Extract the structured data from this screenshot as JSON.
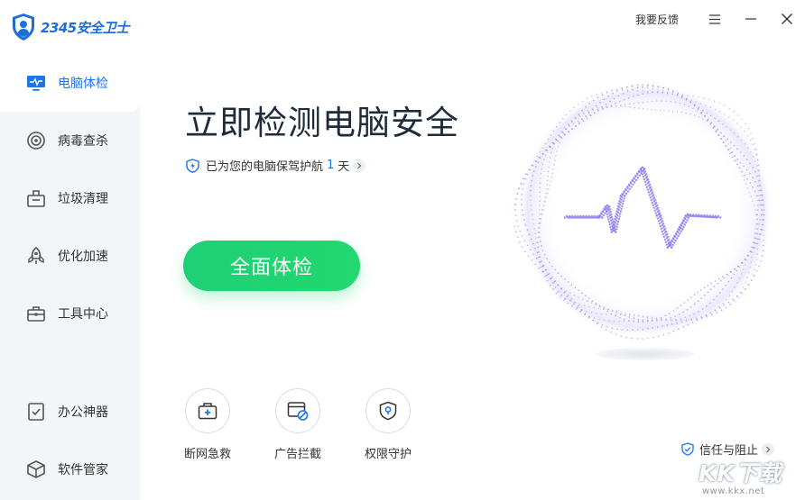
{
  "app": {
    "logo_text": "2345安全卫士",
    "logo_icon": "shield-user-icon",
    "brand_color": "#1e74e8"
  },
  "topbar": {
    "feedback": "我要反馈",
    "menu_icon": "hamburger-icon",
    "minimize_icon": "minimize-icon",
    "close_icon": "close-icon"
  },
  "sidebar": {
    "items": [
      {
        "label": "电脑体检",
        "icon": "monitor-pulse-icon",
        "active": true
      },
      {
        "label": "病毒查杀",
        "icon": "target-icon"
      },
      {
        "label": "垃圾清理",
        "icon": "trash-bin-icon"
      },
      {
        "label": "优化加速",
        "icon": "rocket-icon"
      },
      {
        "label": "工具中心",
        "icon": "toolbox-icon"
      },
      {
        "label": "办公神器",
        "icon": "document-check-icon"
      },
      {
        "label": "软件管家",
        "icon": "cube-icon"
      }
    ]
  },
  "main": {
    "title": "立即检测电脑安全",
    "protect_prefix": "已为您的电脑保驾护航",
    "protect_days": "1",
    "protect_suffix": "天",
    "scan_button": "全面体检",
    "scan_button_color": "#1fcf76"
  },
  "tools": [
    {
      "label": "断网急救",
      "icon": "first-aid-kit-icon"
    },
    {
      "label": "广告拦截",
      "icon": "ad-block-icon"
    },
    {
      "label": "权限守护",
      "icon": "shield-lock-icon"
    }
  ],
  "trust": {
    "label": "信任与阻止"
  },
  "watermark": {
    "text": "KK下载",
    "url": "www.kkx.net"
  }
}
